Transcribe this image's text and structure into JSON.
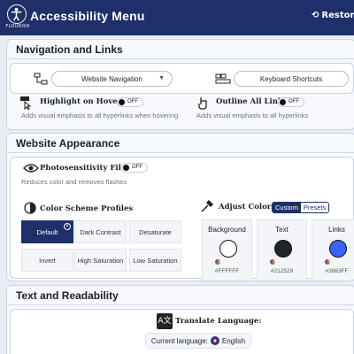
{
  "header": {
    "logo_text": "FLOURISH",
    "title": "Accessibility Menu",
    "restore_label": "Restore d"
  },
  "navigation": {
    "title": "Navigation and Links",
    "website_nav_label": "Website Navigation",
    "keyboard_shortcuts_label": "Keyboard Shortcuts",
    "highlight_hover": {
      "label": "Highlight on Hover",
      "state": "OFF",
      "desc": "Adds visual emphasis to all hyperlinks when hovering"
    },
    "outline_links": {
      "label": "Outline All Links",
      "state": "OFF",
      "desc": "Adds visual emphasis to all hyperlinks"
    }
  },
  "appearance": {
    "title": "Website Appearance",
    "photosensitivity": {
      "label": "Photosensitivity Filter",
      "state": "OFF",
      "desc": "Reduces color and removes flashes"
    },
    "color_scheme": {
      "label": "Color Scheme Profiles",
      "options": [
        "Default",
        "Dark Contrast",
        "Desaturate",
        "Invert",
        "High Saturation",
        "Low Saturation"
      ],
      "selected": "Default"
    },
    "adjust_colors": {
      "label": "Adjust Colors",
      "tabs": [
        "Custom",
        "Presets"
      ],
      "active_tab": "Custom",
      "colors": [
        {
          "name": "Background",
          "hex": "#FFFFFF",
          "value": "#ffffff"
        },
        {
          "name": "Text",
          "hex": "#212529",
          "value": "#212529"
        },
        {
          "name": "Links",
          "hex": "#3863FF",
          "value": "#3863ff"
        }
      ]
    }
  },
  "readability": {
    "title": "Text and Readability",
    "translate": {
      "label": "Translate Language:",
      "current_prefix": "Current language:",
      "current": "English"
    }
  }
}
